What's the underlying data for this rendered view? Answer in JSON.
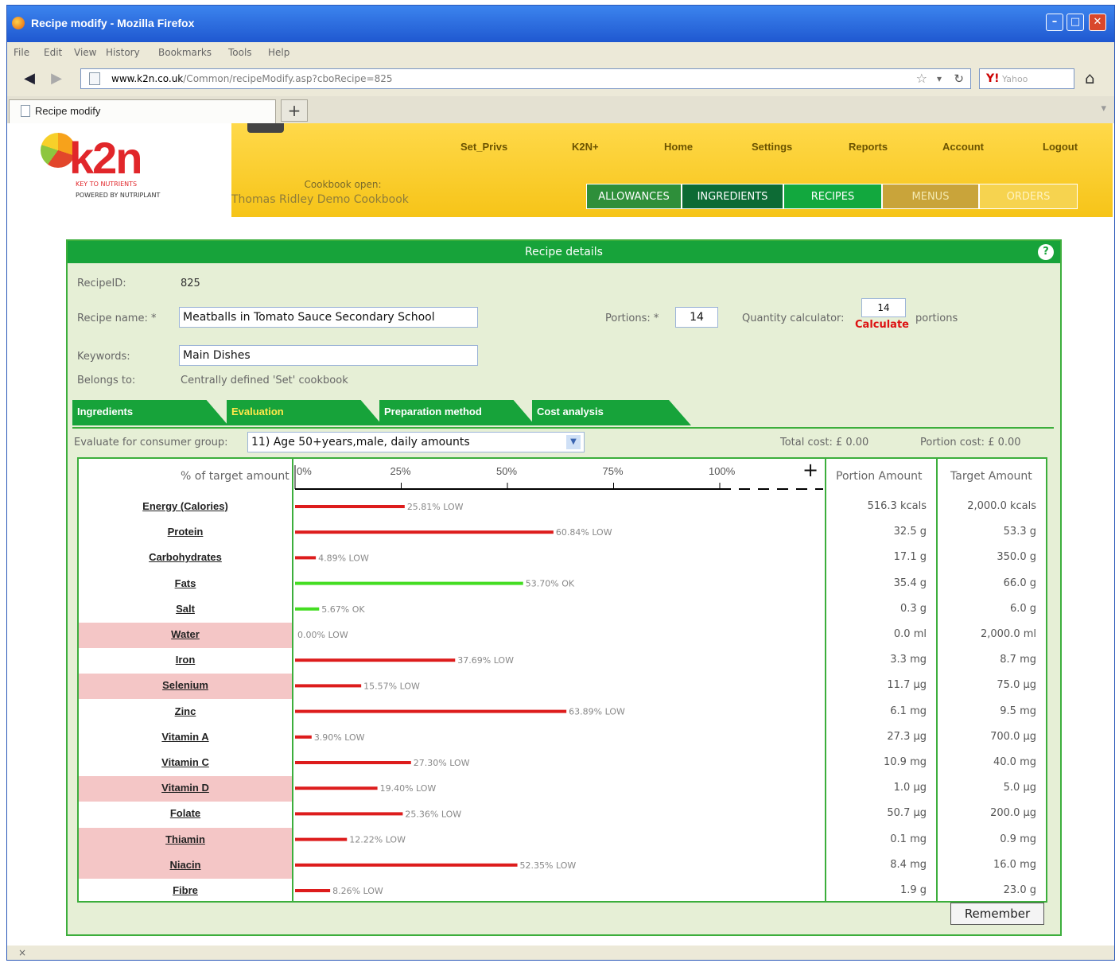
{
  "window": {
    "title": "Recipe modify - Mozilla Firefox"
  },
  "menubar": [
    "File",
    "Edit",
    "View",
    "History",
    "Bookmarks",
    "Tools",
    "Help"
  ],
  "url": {
    "domain": "www.k2n.co.uk",
    "path": "/Common/recipeModify.asp?cboRecipe=825"
  },
  "search_placeholder": "Yahoo",
  "tab": {
    "title": "Recipe modify",
    "new_tab": "+"
  },
  "brand": {
    "name": "k2n",
    "tagline": "KEY TO NUTRIENTS",
    "powered": "POWERED BY NUTRIPLANT"
  },
  "cookbook": {
    "label": "Cookbook open:",
    "name": "Thomas Ridley Demo Cookbook"
  },
  "topnav": [
    "Set_Privs",
    "K2N+",
    "Home",
    "Settings",
    "Reports",
    "Account",
    "Logout"
  ],
  "subnav": [
    "ALLOWANCES",
    "INGREDIENTS",
    "RECIPES",
    "MENUS",
    "ORDERS"
  ],
  "panel": {
    "title": "Recipe details",
    "help": "?"
  },
  "recipe": {
    "id_label": "RecipeID:",
    "id": "825",
    "name_label": "Recipe name: *",
    "name": "Meatballs in Tomato Sauce Secondary School",
    "portions_label": "Portions: *",
    "portions": "14",
    "qty_label": "Quantity calculator:",
    "qty": "14",
    "calculate": "Calculate",
    "portions_word": "portions",
    "keywords_label": "Keywords:",
    "keywords": "Main Dishes",
    "belongs_label": "Belongs to:",
    "belongs": "Centrally defined 'Set' cookbook"
  },
  "inner_tabs": [
    "Ingredients",
    "Evaluation",
    "Preparation method",
    "Cost analysis"
  ],
  "evaluation": {
    "group_label": "Evaluate for consumer group:",
    "group": "11) Age 50+years,male, daily amounts",
    "total_cost": "Total cost: £ 0.00",
    "portion_cost": "Portion cost: £ 0.00"
  },
  "table": {
    "pct_header": "% of target amount",
    "portion_header": "Portion Amount",
    "target_header": "Target Amount",
    "plus": "+"
  },
  "chart_data": {
    "type": "bar",
    "orientation": "horizontal",
    "ticks": [
      "0%",
      "25%",
      "50%",
      "75%",
      "100%"
    ],
    "xlim": [
      0,
      120
    ],
    "rows": [
      {
        "name": "Energy (Calories)",
        "pct": 25.81,
        "label": "25.81% LOW",
        "status": "low",
        "portion": "516.3 kcals",
        "target": "2,000.0 kcals",
        "highlight": false
      },
      {
        "name": "Protein",
        "pct": 60.84,
        "label": "60.84% LOW",
        "status": "low",
        "portion": "32.5 g",
        "target": "53.3 g",
        "highlight": false
      },
      {
        "name": "Carbohydrates",
        "pct": 4.89,
        "label": "4.89% LOW",
        "status": "low",
        "portion": "17.1 g",
        "target": "350.0 g",
        "highlight": false
      },
      {
        "name": "Fats",
        "pct": 53.7,
        "label": "53.70% OK",
        "status": "ok",
        "portion": "35.4 g",
        "target": "66.0 g",
        "highlight": false
      },
      {
        "name": "Salt",
        "pct": 5.67,
        "label": "5.67% OK",
        "status": "ok",
        "portion": "0.3 g",
        "target": "6.0 g",
        "highlight": false
      },
      {
        "name": "Water",
        "pct": 0,
        "label": "0.00% LOW",
        "status": "low",
        "portion": "0.0 ml",
        "target": "2,000.0 ml",
        "highlight": true
      },
      {
        "name": "Iron",
        "pct": 37.69,
        "label": "37.69% LOW",
        "status": "low",
        "portion": "3.3 mg",
        "target": "8.7 mg",
        "highlight": false
      },
      {
        "name": "Selenium",
        "pct": 15.57,
        "label": "15.57% LOW",
        "status": "low",
        "portion": "11.7 µg",
        "target": "75.0 µg",
        "highlight": true
      },
      {
        "name": "Zinc",
        "pct": 63.89,
        "label": "63.89% LOW",
        "status": "low",
        "portion": "6.1 mg",
        "target": "9.5 mg",
        "highlight": false
      },
      {
        "name": "Vitamin A",
        "pct": 3.9,
        "label": "3.90% LOW",
        "status": "low",
        "portion": "27.3 µg",
        "target": "700.0 µg",
        "highlight": false
      },
      {
        "name": "Vitamin C",
        "pct": 27.3,
        "label": "27.30% LOW",
        "status": "low",
        "portion": "10.9 mg",
        "target": "40.0 mg",
        "highlight": false
      },
      {
        "name": "Vitamin D",
        "pct": 19.4,
        "label": "19.40% LOW",
        "status": "low",
        "portion": "1.0 µg",
        "target": "5.0 µg",
        "highlight": true
      },
      {
        "name": "Folate",
        "pct": 25.36,
        "label": "25.36% LOW",
        "status": "low",
        "portion": "50.7 µg",
        "target": "200.0 µg",
        "highlight": false
      },
      {
        "name": "Thiamin",
        "pct": 12.22,
        "label": "12.22% LOW",
        "status": "low",
        "portion": "0.1 mg",
        "target": "0.9 mg",
        "highlight": true
      },
      {
        "name": "Niacin",
        "pct": 52.35,
        "label": "52.35% LOW",
        "status": "low",
        "portion": "8.4 mg",
        "target": "16.0 mg",
        "highlight": true
      },
      {
        "name": "Fibre",
        "pct": 8.26,
        "label": "8.26% LOW",
        "status": "low",
        "portion": "1.9 g",
        "target": "23.0 g",
        "highlight": false
      }
    ],
    "colors": {
      "low": "#dd1c1c",
      "ok": "#44dd22"
    }
  },
  "remember": "Remember",
  "status": "×"
}
